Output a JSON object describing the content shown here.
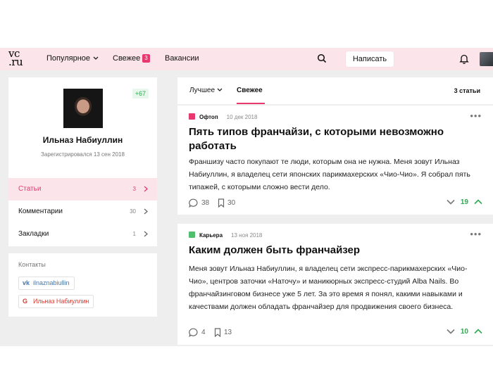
{
  "header": {
    "logo_top": "vc",
    "logo_bottom": ".ru",
    "nav": {
      "popular": "Популярное",
      "fresh": "Свежее",
      "fresh_badge": "3",
      "jobs": "Вакансии"
    },
    "write_label": "Написать"
  },
  "profile": {
    "karma": "+67",
    "name": "Ильназ Набиуллин",
    "registered": "Зарегистрировался 13 сен 2018",
    "menu": [
      {
        "label": "Статьи",
        "count": "3"
      },
      {
        "label": "Комментарии",
        "count": "30"
      },
      {
        "label": "Закладки",
        "count": "1"
      }
    ]
  },
  "contacts": {
    "title": "Контакты",
    "vk_icon": "vk",
    "vk_label": "ilnaznabiullin",
    "google_icon": "G",
    "google_label": "Ильназ Набиуллин"
  },
  "feed": {
    "tab_best": "Лучшее",
    "tab_fresh": "Свежее",
    "count": "3 статьи",
    "posts": [
      {
        "category": "Офтоп",
        "category_color": "#e8386d",
        "date": "10 дек 2018",
        "title": "Пять типов франчайзи, с которыми невозможно работать",
        "text": "Франшизу часто покупают те люди, которым она не нужна. Меня зовут Ильназ Набиуллин, я владелец сети японских парикмахерских «Чио-Чио». Я собрал пять типажей, с которыми сложно вести дело.",
        "comments": "38",
        "bookmarks": "30",
        "rating": "19"
      },
      {
        "category": "Карьера",
        "category_color": "#4fbf6e",
        "date": "13 ноя 2018",
        "title": "Каким должен быть франчайзер",
        "text": "Меня зовут Ильназ Набиуллин, я владелец сети экспресс-парикмахерских «Чио-Чио», центров заточки «Наточу» и маникюрных экспресс-студий Alba Nails. Во франчайзинговом бизнесе уже 5 лет. За это время я понял, какими навыками и качествами должен обладать франчайзер для продвижения своего бизнеса.",
        "comments": "4",
        "bookmarks": "13",
        "rating": "10"
      }
    ]
  },
  "colors": {
    "accent": "#e8386d",
    "header_bg": "#fbe4ea",
    "positive": "#2fa84f"
  }
}
